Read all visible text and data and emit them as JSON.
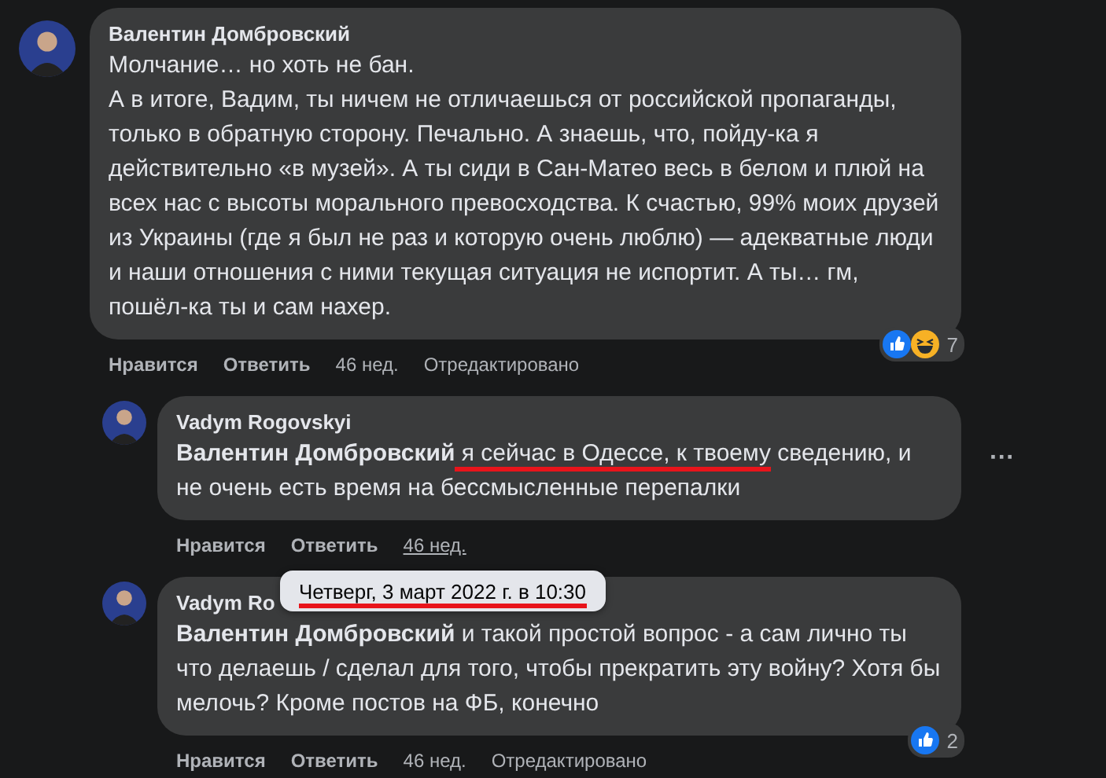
{
  "comments": [
    {
      "author": "Валентин Домбровский",
      "paragraphs": [
        [
          {
            "text": "Молчание… но хоть не бан."
          }
        ],
        [
          {
            "text": "А в итоге, Вадим, ты ничем не отличаешься от российской пропаганды, только в обратную сторону. Печально. А знаешь, что, пойду-ка я действительно «в музей». А ты сиди в Сан-Матео весь в белом и плюй на всех нас с высоты морального превосходства. К счастью, 99% моих друзей из Украины (где я был не раз и которую очень люблю) — адекватные люди и наши отношения с ними текущая ситуация не испортит. А ты… гм, пошёл-ка ты и сам нахер."
          }
        ]
      ],
      "reactions": {
        "icons": [
          {
            "kind": "like"
          },
          {
            "kind": "haha"
          }
        ],
        "count": "7"
      },
      "actions": [
        {
          "kind": "link",
          "label": "Нравится"
        },
        {
          "kind": "link",
          "label": "Ответить"
        },
        {
          "kind": "time",
          "label": "46 нед.",
          "underlined": false
        },
        {
          "kind": "note",
          "label": "Отредактировано"
        }
      ],
      "replies": [
        {
          "author": "Vadym Rogovskyi",
          "menu": "···",
          "paragraphs": [
            [
              {
                "text": "Валентин Домбровский",
                "bold": true
              },
              {
                "text": " я сейчас в Одессе, к твоему",
                "underlined": true
              },
              {
                "text": " сведению, и не очень есть время на бессмысленные перепалки"
              }
            ]
          ],
          "actions": [
            {
              "kind": "link",
              "label": "Нравится"
            },
            {
              "kind": "link",
              "label": "Ответить"
            },
            {
              "kind": "time",
              "label": "46 нед.",
              "underlined": true
            }
          ]
        },
        {
          "author": "Vadym Ro",
          "tooltip": {
            "text": "Четверг, 3 март 2022 г. в 10:30",
            "underlined": true
          },
          "paragraphs": [
            [
              {
                "text": "Валентин Домбровский",
                "bold": true
              },
              {
                "text": " и такой простой вопрос - а сам лично ты что делаешь / сделал для того, чтобы прекратить эту войну? Хотя бы мелочь? Кроме постов на ФБ, конечно"
              }
            ]
          ],
          "reactions": {
            "icons": [
              {
                "kind": "like"
              }
            ],
            "count": "2"
          },
          "actions": [
            {
              "kind": "link",
              "label": "Нравится"
            },
            {
              "kind": "link",
              "label": "Ответить"
            },
            {
              "kind": "time",
              "label": "46 нед.",
              "underlined": false
            },
            {
              "kind": "note",
              "label": "Отредактировано"
            }
          ]
        }
      ]
    }
  ]
}
